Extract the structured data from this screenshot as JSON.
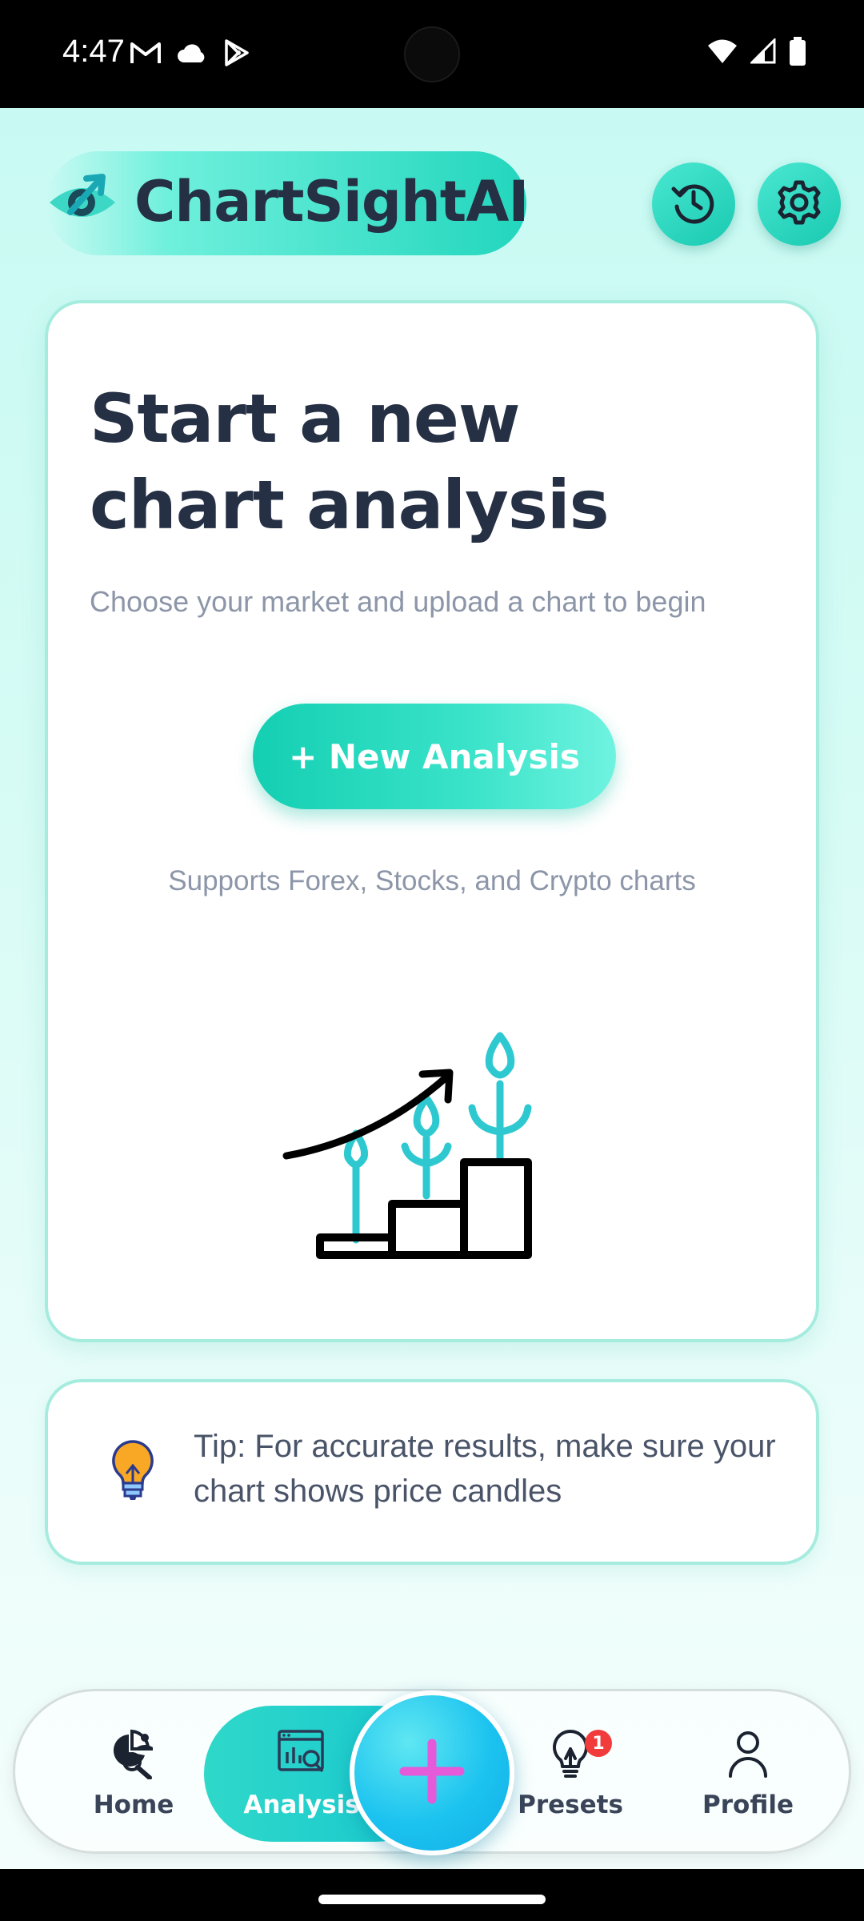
{
  "status_bar": {
    "time": "4:47",
    "left_icons": [
      "gmail-icon",
      "cloud-icon",
      "play-store-icon"
    ],
    "right_icons": [
      "wifi-icon",
      "signal-icon",
      "battery-icon"
    ]
  },
  "header": {
    "app_name": "ChartSightAI",
    "logo_icon": "eye-arrow-logo-icon",
    "history_icon": "history-icon",
    "settings_icon": "gear-icon"
  },
  "main_card": {
    "title": "Start a new chart analysis",
    "subtitle": "Choose your market and upload a chart to begin",
    "new_analysis_label": "+ New Analysis",
    "supports_text": "Supports Forex, Stocks, and Crypto charts",
    "illustration": "growth-chart-icon"
  },
  "tip": {
    "icon": "lightbulb-icon",
    "text": "Tip: For accurate results, make sure your chart shows price candles"
  },
  "bottom_nav": {
    "items": [
      {
        "label": "Home",
        "icon": "home-analytics-icon",
        "active": false
      },
      {
        "label": "Analysis",
        "icon": "analysis-icon",
        "active": true
      },
      {
        "label": "Presets",
        "icon": "lightbulb-outline-icon",
        "active": false,
        "badge": "1"
      },
      {
        "label": "Profile",
        "icon": "user-icon",
        "active": false
      }
    ],
    "fab_icon": "plus-icon"
  },
  "colors": {
    "accent": "#1fd3b7",
    "text_dark": "#253044",
    "text_muted": "#8c96a8",
    "badge": "#f23b3b",
    "fab_plus": "#e45ad9"
  }
}
